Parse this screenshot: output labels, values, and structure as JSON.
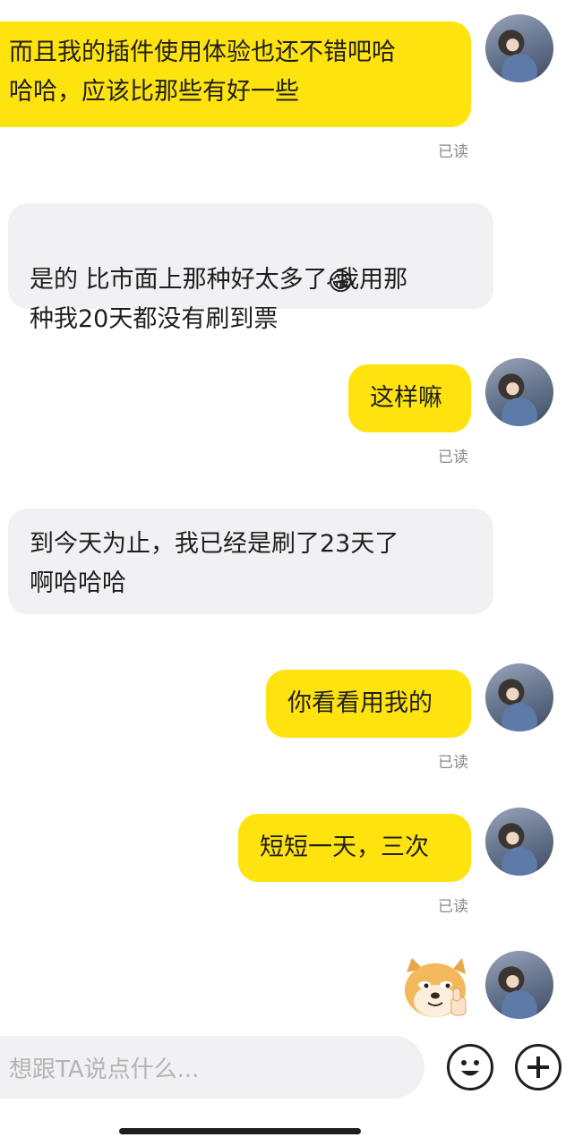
{
  "messages": [
    {
      "text": "而且我的插件使用体验也还不错吧哈\n哈哈，应该比那些有好一些",
      "read": "已读"
    },
    {
      "text": "是的 比市面上那种好太多了 我用那\n种我20天都没有刷到票",
      "emoji": "laughing-tears"
    },
    {
      "text": "这样嘛",
      "read": "已读"
    },
    {
      "text": "到今天为止，我已经是刷了23天了\n啊哈哈哈"
    },
    {
      "text": "你看看用我的",
      "read": "已读"
    },
    {
      "text": "短短一天，三次",
      "read": "已读"
    },
    {
      "sticker": "doge-thumbs-up"
    }
  ],
  "emoji_glyph": "😂",
  "input": {
    "placeholder": "想跟TA说点什么..."
  },
  "icons": {
    "emoji_button": "smiley-icon",
    "add_button": "plus-icon"
  },
  "colors": {
    "my_bubble": "#ffe30f",
    "their_bubble": "#f1f1f3",
    "read_label": "#8a8a8a"
  }
}
